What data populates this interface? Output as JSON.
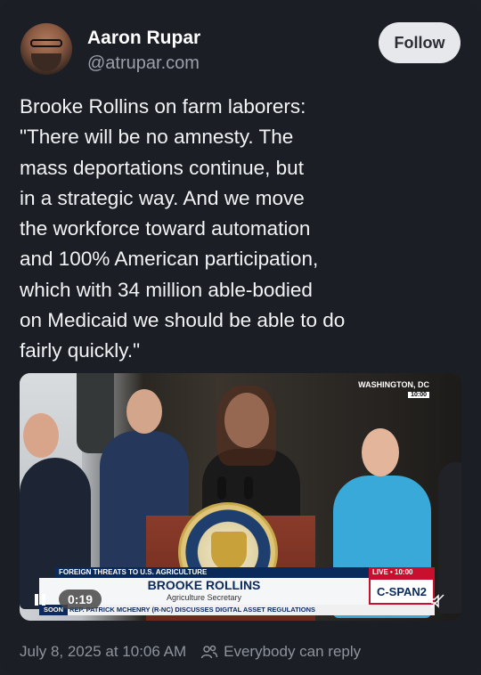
{
  "author": {
    "name": "Aaron Rupar",
    "handle": "@atrupar.com"
  },
  "follow_label": "Follow",
  "post": {
    "text": "Brooke Rollins on farm laborers:\n\"There will be no amnesty. The\nmass deportations continue, but\nin a strategic way. And we move\nthe workforce toward automation\nand 100% American participation,\nwhich with 34 million able-bodied\non Medicaid we should be able to do\nfairly quickly.\""
  },
  "video": {
    "location": "WASHINGTON, DC",
    "clock": "10:00",
    "lower_bar": "FOREIGN THREATS TO U.S. AGRICULTURE",
    "live_label": "LIVE • 10:00",
    "speaker_name": "BROOKE ROLLINS",
    "speaker_title": "Agriculture Secretary",
    "network": "C-SPAN2",
    "ticker_label": "SOON",
    "ticker_text": "REP. PATRICK MCHENRY (R-NC) DISCUSSES DIGITAL ASSET REGULATIONS",
    "timecode": "0:19"
  },
  "meta": {
    "date": "July 8, 2025 at 10:06 AM",
    "reply_setting": "Everybody can reply"
  },
  "icons": {
    "pause": "pause-icon",
    "mute": "mute-icon",
    "reply": "people-icon"
  }
}
